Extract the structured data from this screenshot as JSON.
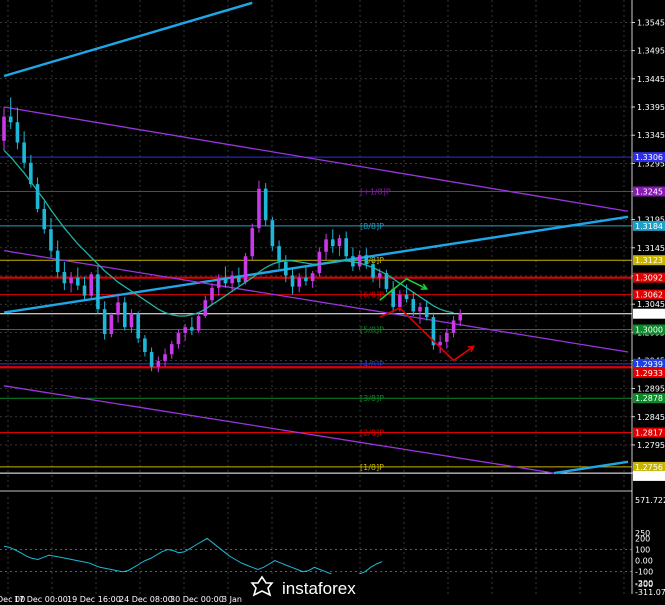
{
  "chart_data": [
    {
      "type": "candlestick",
      "title": "",
      "ylim": [
        1.2715,
        1.3585
      ],
      "y_ticks": [
        "1.3545",
        "1.3495",
        "1.3445",
        "1.3395",
        "1.3345",
        "1.3295",
        "1.3245",
        "1.3195",
        "1.3145",
        "1.3095",
        "1.3045",
        "1.2995",
        "1.2945",
        "1.2895",
        "1.2845",
        "1.2795",
        "1.2745"
      ],
      "x_labels": [
        "Dec 00",
        "17 Dec 00:00",
        "19 Dec 16:00",
        "24 Dec 08:00",
        "30 Dec 00:00",
        "3 Jan"
      ],
      "candles": [
        [
          1.3335,
          1.3395,
          1.3318,
          1.3378
        ],
        [
          1.3378,
          1.3412,
          1.3356,
          1.3368
        ],
        [
          1.3368,
          1.3394,
          1.332,
          1.3332
        ],
        [
          1.3332,
          1.3352,
          1.3286,
          1.3296
        ],
        [
          1.3296,
          1.331,
          1.3252,
          1.3258
        ],
        [
          1.3258,
          1.327,
          1.3208,
          1.3214
        ],
        [
          1.3214,
          1.3228,
          1.317,
          1.3178
        ],
        [
          1.3178,
          1.3198,
          1.3128,
          1.314
        ],
        [
          1.314,
          1.3158,
          1.3092,
          1.3102
        ],
        [
          1.3102,
          1.312,
          1.307,
          1.3082
        ],
        [
          1.3082,
          1.3102,
          1.3066,
          1.3092
        ],
        [
          1.3092,
          1.311,
          1.307,
          1.3078
        ],
        [
          1.3078,
          1.3094,
          1.3052,
          1.306
        ],
        [
          1.306,
          1.3102,
          1.3056,
          1.3098
        ],
        [
          1.3098,
          1.3112,
          1.3028,
          1.3036
        ],
        [
          1.3036,
          1.305,
          1.2982,
          1.2992
        ],
        [
          1.2992,
          1.303,
          1.2986,
          1.3026
        ],
        [
          1.3026,
          1.3064,
          1.3012,
          1.3048
        ],
        [
          1.3048,
          1.3058,
          1.2998,
          1.3004
        ],
        [
          1.3004,
          1.3036,
          1.2994,
          1.3028
        ],
        [
          1.3028,
          1.3032,
          1.2976,
          1.2984
        ],
        [
          1.2984,
          1.299,
          1.2952,
          1.296
        ],
        [
          1.296,
          1.2968,
          1.2926,
          1.2934
        ],
        [
          1.2934,
          1.2952,
          1.2924,
          1.2944
        ],
        [
          1.2944,
          1.2966,
          1.2934,
          1.2956
        ],
        [
          1.2956,
          1.298,
          1.2948,
          1.2974
        ],
        [
          1.2974,
          1.3,
          1.2966,
          1.2994
        ],
        [
          1.2994,
          1.301,
          1.298,
          1.3004
        ],
        [
          1.3004,
          1.3022,
          1.299,
          1.2998
        ],
        [
          1.2998,
          1.303,
          1.2994,
          1.3024
        ],
        [
          1.3024,
          1.306,
          1.302,
          1.3052
        ],
        [
          1.3052,
          1.3082,
          1.3044,
          1.3074
        ],
        [
          1.3074,
          1.3098,
          1.306,
          1.309
        ],
        [
          1.309,
          1.3112,
          1.3074,
          1.3082
        ],
        [
          1.3082,
          1.3104,
          1.3066,
          1.3096
        ],
        [
          1.3096,
          1.311,
          1.3078,
          1.3084
        ],
        [
          1.3084,
          1.3136,
          1.308,
          1.313
        ],
        [
          1.313,
          1.3188,
          1.3124,
          1.318
        ],
        [
          1.318,
          1.3264,
          1.3172,
          1.325
        ],
        [
          1.325,
          1.326,
          1.3184,
          1.3194
        ],
        [
          1.3194,
          1.32,
          1.314,
          1.3148
        ],
        [
          1.3148,
          1.3158,
          1.3108,
          1.312
        ],
        [
          1.312,
          1.3132,
          1.3084,
          1.3096
        ],
        [
          1.3096,
          1.311,
          1.3062,
          1.3076
        ],
        [
          1.3076,
          1.31,
          1.3066,
          1.3092
        ],
        [
          1.3092,
          1.311,
          1.3078,
          1.3086
        ],
        [
          1.3086,
          1.3104,
          1.3074,
          1.31
        ],
        [
          1.31,
          1.3146,
          1.3094,
          1.3138
        ],
        [
          1.3138,
          1.317,
          1.3124,
          1.316
        ],
        [
          1.316,
          1.3178,
          1.3136,
          1.3148
        ],
        [
          1.3148,
          1.3168,
          1.313,
          1.3162
        ],
        [
          1.3162,
          1.3174,
          1.312,
          1.313
        ],
        [
          1.313,
          1.3146,
          1.3104,
          1.3112
        ],
        [
          1.3112,
          1.314,
          1.3106,
          1.3132
        ],
        [
          1.3132,
          1.3144,
          1.3108,
          1.3116
        ],
        [
          1.3116,
          1.3122,
          1.3084,
          1.3092
        ],
        [
          1.3092,
          1.3108,
          1.3074,
          1.31
        ],
        [
          1.31,
          1.3106,
          1.3066,
          1.3072
        ],
        [
          1.3072,
          1.3086,
          1.303,
          1.304
        ],
        [
          1.304,
          1.307,
          1.3032,
          1.3062
        ],
        [
          1.3062,
          1.308,
          1.3048,
          1.3054
        ],
        [
          1.3054,
          1.3066,
          1.3024,
          1.3032
        ],
        [
          1.3032,
          1.3048,
          1.301,
          1.304
        ],
        [
          1.304,
          1.3052,
          1.3016,
          1.3022
        ],
        [
          1.3022,
          1.303,
          1.2964,
          1.2972
        ],
        [
          1.2972,
          1.299,
          1.2958,
          1.2978
        ],
        [
          1.2978,
          1.3002,
          1.2966,
          1.2994
        ],
        [
          1.2994,
          1.3024,
          1.2986,
          1.3016
        ],
        [
          1.3016,
          1.3036,
          1.3006,
          1.3028
        ]
      ],
      "moving_average": [
        1.3318,
        1.3306,
        1.3292,
        1.3278,
        1.3262,
        1.3246,
        1.323,
        1.3212,
        1.3196,
        1.318,
        1.3166,
        1.3152,
        1.314,
        1.3128,
        1.3116,
        1.3104,
        1.3094,
        1.3084,
        1.3076,
        1.3068,
        1.306,
        1.3052,
        1.3044,
        1.3036,
        1.303,
        1.3026,
        1.3024,
        1.3024,
        1.3026,
        1.303,
        1.3036,
        1.3044,
        1.3052,
        1.306,
        1.3068,
        1.3076,
        1.3084,
        1.3092,
        1.3102,
        1.311,
        1.3116,
        1.312,
        1.3122,
        1.3122,
        1.312,
        1.3118,
        1.3116,
        1.3116,
        1.3118,
        1.312,
        1.3122,
        1.3122,
        1.312,
        1.3118,
        1.3114,
        1.311,
        1.3104,
        1.3098,
        1.309,
        1.3082,
        1.3074,
        1.3066,
        1.3058,
        1.305,
        1.3042,
        1.3036,
        1.3032,
        1.303
      ],
      "levels": [
        {
          "label": "1.3306",
          "price": 1.3306,
          "color": "#2e2ee8",
          "tag": ""
        },
        {
          "label": "1.3245",
          "price": 1.3245,
          "color": "#8a1ab8",
          "tag": "[+1/8]P"
        },
        {
          "label": "1.3184",
          "price": 1.3184,
          "color": "#1e9fc7",
          "tag": "[8/8]P"
        },
        {
          "label": "1.3123",
          "price": 1.3123,
          "color": "#c8b400",
          "tag": "[7/8]P"
        },
        {
          "label": "1.3092",
          "price": 1.3092,
          "color": "#e00000",
          "tag": ""
        },
        {
          "label": "1.3062",
          "price": 1.3062,
          "color": "#e00000",
          "tag": "[6/8]P"
        },
        {
          "label": "1.3028",
          "price": 1.3028,
          "color": "#ffffff",
          "tag": ""
        },
        {
          "label": "1.3000",
          "price": 1.3,
          "color": "#0b8a2a",
          "tag": "[5/8]P"
        },
        {
          "label": "1.2939",
          "price": 1.2939,
          "color": "#1f3fe0",
          "tag": "[4/8]P"
        },
        {
          "label": "1.2933",
          "price": 1.2933,
          "color": "#e00000",
          "tag": ""
        },
        {
          "label": "1.2878",
          "price": 1.2878,
          "color": "#0b8a2a",
          "tag": "[3/8]P"
        },
        {
          "label": "1.2817",
          "price": 1.2817,
          "color": "#e00000",
          "tag": "[2/8]P"
        },
        {
          "label": "1.2756",
          "price": 1.2756,
          "color": "#c8b400",
          "tag": "[1/8]P"
        },
        {
          "label": "1.2745",
          "price": 1.2745,
          "color": "#ffffff",
          "tag": ""
        }
      ],
      "trend_lines": [
        {
          "color": "#1ea7e8",
          "from": [
            0,
            1.345
          ],
          "to": [
            37,
            1.358
          ]
        },
        {
          "color": "#1ea7e8",
          "from": [
            0,
            1.303
          ],
          "to": [
            93,
            1.32
          ]
        },
        {
          "color": "#9b34e0",
          "from": [
            0,
            1.3395
          ],
          "to": [
            93,
            1.321
          ]
        },
        {
          "color": "#9b34e0",
          "from": [
            0,
            1.314
          ],
          "to": [
            93,
            1.296
          ]
        },
        {
          "color": "#9b34e0",
          "from": [
            0,
            1.29
          ],
          "to": [
            82,
            1.2745
          ]
        },
        {
          "color": "#1ea7e8",
          "from": [
            82,
            1.2745
          ],
          "to": [
            93,
            1.2765
          ]
        }
      ],
      "projections": [
        {
          "color": "#22cc33",
          "from": [
            56,
            1.3052
          ],
          "mid": [
            60,
            1.309
          ],
          "to": [
            63,
            1.3072
          ]
        },
        {
          "color": "#e00000",
          "from": [
            56,
            1.3022
          ],
          "mid": [
            59,
            1.3038
          ],
          "to": [
            67,
            1.2945
          ],
          "end": [
            70,
            1.297
          ]
        }
      ]
    },
    {
      "type": "line",
      "title": "",
      "ylim": [
        -300,
        571.7224
      ],
      "y_ticks": [
        "571.7224",
        "250",
        "200",
        "100",
        "0.00",
        "-100",
        "-200",
        "-300",
        "-311.0700"
      ],
      "values": [
        130,
        120,
        95,
        70,
        40,
        20,
        10,
        30,
        50,
        40,
        30,
        20,
        10,
        0,
        -10,
        -20,
        -40,
        -60,
        -70,
        -80,
        -90,
        -100,
        -90,
        -60,
        -30,
        0,
        20,
        50,
        80,
        100,
        90,
        70,
        80,
        110,
        140,
        170,
        200,
        160,
        120,
        80,
        40,
        10,
        -20,
        -40,
        -60,
        -80,
        -60,
        -30,
        0,
        -20,
        -40,
        -60,
        -80,
        -100,
        -90,
        -60,
        -80,
        -100,
        -120,
        -140,
        -160,
        -170,
        -150,
        -120,
        -100,
        -60,
        -30,
        -10
      ],
      "hlines": [
        100,
        -100
      ]
    }
  ],
  "watermark": "instaforex"
}
